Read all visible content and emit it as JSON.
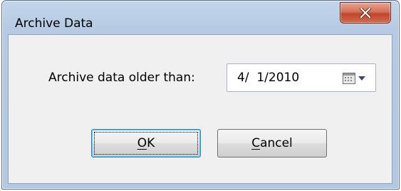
{
  "window": {
    "title": "Archive Data"
  },
  "titlebar": {
    "close_icon": "close-x-icon"
  },
  "form": {
    "prompt_label": "Archive data older than:",
    "date_value": "4/  1/2010",
    "dropdown_icon": "calendar-dropdown-icon"
  },
  "buttons": {
    "ok": {
      "mnemonic": "O",
      "rest": "K"
    },
    "cancel": {
      "mnemonic": "C",
      "rest": "ancel"
    }
  },
  "colors": {
    "close_button": "#c7503a",
    "focus_border": "#3c7fb1",
    "frame": "#b3c8e1",
    "client": "#f0f0f0"
  }
}
